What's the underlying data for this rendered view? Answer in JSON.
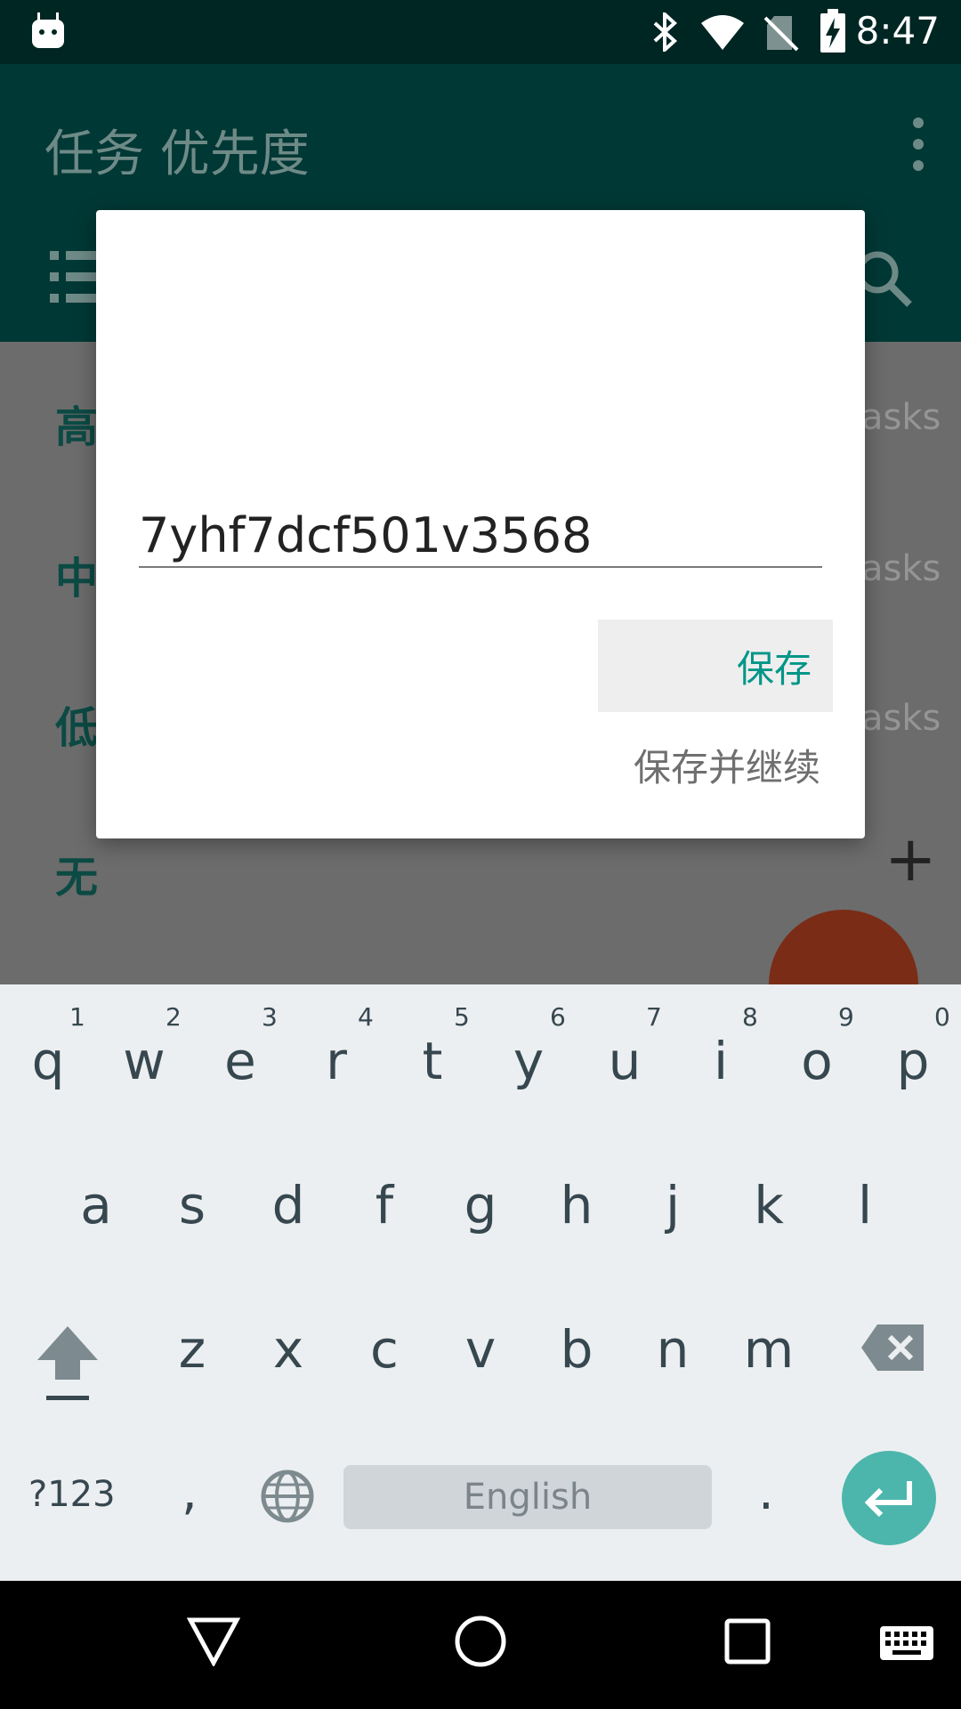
{
  "status_bar": {
    "time": "8:47"
  },
  "app_bar": {
    "title": "任务 优先度"
  },
  "list": {
    "rows": [
      {
        "label": "高",
        "right": "asks"
      },
      {
        "label": "中",
        "right": "asks"
      },
      {
        "label": "低",
        "right": "asks"
      },
      {
        "label": "无",
        "right": "+"
      }
    ]
  },
  "dialog": {
    "input_value": "7yhf7dcf501v3568",
    "save_label": "保存",
    "save_continue_label": "保存并继续"
  },
  "keyboard": {
    "row1": [
      "q",
      "w",
      "e",
      "r",
      "t",
      "y",
      "u",
      "i",
      "o",
      "p"
    ],
    "row1_hints": [
      "1",
      "2",
      "3",
      "4",
      "5",
      "6",
      "7",
      "8",
      "9",
      "0"
    ],
    "row2": [
      "a",
      "s",
      "d",
      "f",
      "g",
      "h",
      "j",
      "k",
      "l"
    ],
    "row3": [
      "z",
      "x",
      "c",
      "v",
      "b",
      "n",
      "m"
    ],
    "symbols_label": "?123",
    "comma": ",",
    "space_label": "English",
    "period": "."
  },
  "colors": {
    "status_bar": "#002623",
    "app_bar": "#003835",
    "accent": "#009688",
    "fab": "#7a2c17",
    "enter_key": "#4db6ac"
  }
}
